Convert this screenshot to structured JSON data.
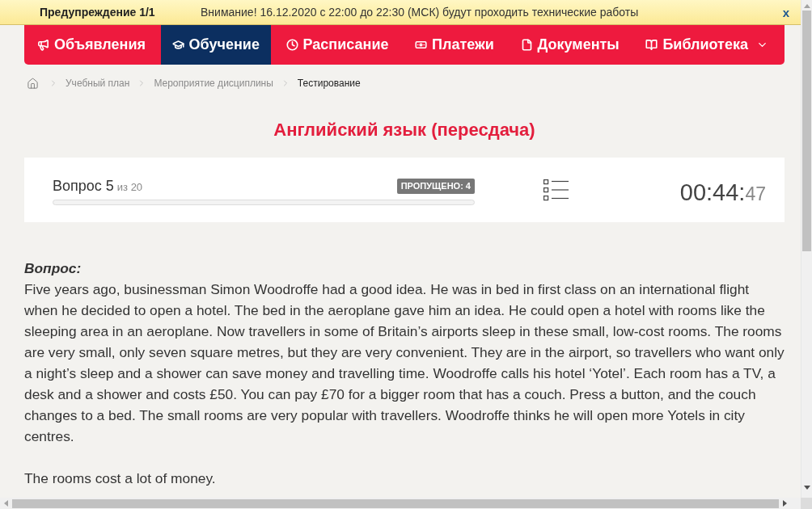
{
  "alert_bar": {
    "title": "Предупреждение 1/1",
    "message": "Внимание! 16.12.2020 с 22:00 до 22:30 (МСК) будут проходить технические работы",
    "close": "x"
  },
  "nav": {
    "items": [
      {
        "label": "Объявления",
        "selected": false,
        "dropdown": false
      },
      {
        "label": "Обучение",
        "selected": true,
        "dropdown": false
      },
      {
        "label": "Расписание",
        "selected": false,
        "dropdown": false
      },
      {
        "label": "Платежи",
        "selected": false,
        "dropdown": false
      },
      {
        "label": "Документы",
        "selected": false,
        "dropdown": false
      },
      {
        "label": "Библиотека",
        "selected": false,
        "dropdown": true
      }
    ]
  },
  "breadcrumb": {
    "items": [
      {
        "label": "Учебный план",
        "current": false
      },
      {
        "label": "Мероприятие дисциплины",
        "current": false
      },
      {
        "label": "Тестирование",
        "current": true
      }
    ]
  },
  "title": "Английский язык (пересдача)",
  "progress_card": {
    "question": "Вопрос 5",
    "total": "из 20",
    "skipped_badge": "ПРОПУЩЕНО: 4",
    "timer": {
      "time": "00:44:",
      "seconds": "47"
    }
  },
  "question": {
    "label": "Вопрос:",
    "text": "Five years ago, businessman Simon Woodroffe had a good idea. He was in bed in first class on an international flight when he decided to open a hotel. The bed in the aeroplane gave him an idea. He could open a hotel with rooms like the sleeping area in an aeroplane. Now travellers in some of Britain’s airports sleep in these small, low-cost rooms. The rooms are very small, only seven square metres, but they are very convenient. They are in the airport, so travellers who want only a night’s sleep and a shower can save money and travelling time. Woodroffe calls his hotel ‘Yotel’. Each room has a TV, a desk and a shower and costs £50. You can pay £70 for a bigger room that has a couch. Press a button, and the couch changes to a bed. The small rooms are very popular with travellers. Woodroffe thinks he will open more Yotels in city centres.",
    "statement": "The rooms cost a lot of money."
  }
}
